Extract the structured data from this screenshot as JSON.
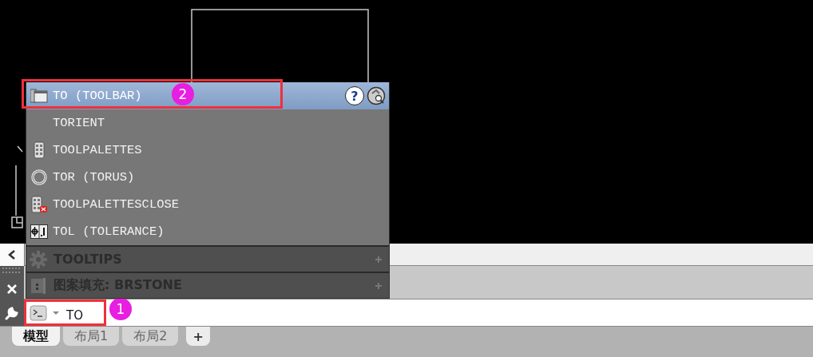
{
  "autocomplete": {
    "items": [
      {
        "label": "TO (TOOLBAR)",
        "kind": "toolbar",
        "selected": true
      },
      {
        "label": "TORIENT",
        "kind": "plain",
        "selected": false
      },
      {
        "label": "TOOLPALETTES",
        "kind": "palettes",
        "selected": false
      },
      {
        "label": "TOR (TORUS)",
        "kind": "torus",
        "selected": false
      },
      {
        "label": "TOOLPALETTESCLOSE",
        "kind": "palettes_close",
        "selected": false
      },
      {
        "label": "TOL (TOLERANCE)",
        "kind": "tolerance",
        "selected": false
      }
    ],
    "help_button": "?",
    "sections": [
      {
        "label": "TOOLTIPS",
        "kind": "settings"
      },
      {
        "label": "图案填充: BRSTONE",
        "kind": "hatch"
      }
    ]
  },
  "callouts": {
    "suggestion": "2",
    "command": "1"
  },
  "command_line": {
    "value": "TO"
  },
  "layout_tabs": [
    {
      "label": "模型",
      "selected": true
    },
    {
      "label": "布局1",
      "selected": false
    },
    {
      "label": "布局2",
      "selected": false
    }
  ],
  "new_tab_button": "+"
}
